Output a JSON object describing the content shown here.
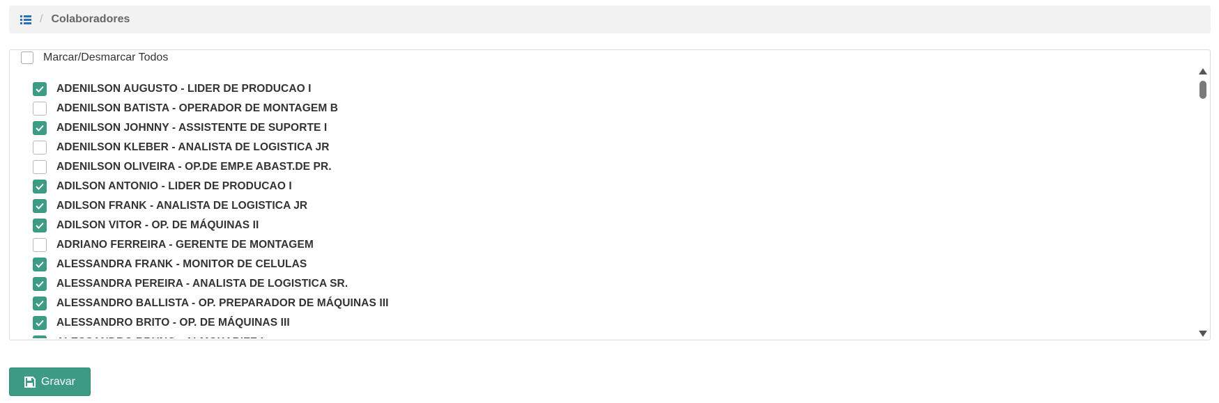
{
  "breadcrumb": {
    "icon": "list-icon",
    "separator": "/",
    "current": "Colaboradores"
  },
  "select_all": {
    "label": "Marcar/Desmarcar Todos",
    "checked": false
  },
  "colors": {
    "accent": "#3d9a85",
    "breadcrumb_bg": "#f2f2f2"
  },
  "collaborators": [
    {
      "label": "ADENILSON AUGUSTO - LIDER DE PRODUCAO I",
      "checked": true
    },
    {
      "label": "ADENILSON BATISTA - OPERADOR DE MONTAGEM B",
      "checked": false
    },
    {
      "label": "ADENILSON JOHNNY - ASSISTENTE DE SUPORTE I",
      "checked": true
    },
    {
      "label": "ADENILSON KLEBER - ANALISTA DE LOGISTICA JR",
      "checked": false
    },
    {
      "label": "ADENILSON OLIVEIRA - OP.DE EMP.E ABAST.DE PR.",
      "checked": false
    },
    {
      "label": "ADILSON ANTONIO - LIDER DE PRODUCAO I",
      "checked": true
    },
    {
      "label": "ADILSON FRANK - ANALISTA DE LOGISTICA JR",
      "checked": true
    },
    {
      "label": "ADILSON VITOR - OP. DE MÁQUINAS II",
      "checked": true
    },
    {
      "label": "ADRIANO FERREIRA - GERENTE DE MONTAGEM",
      "checked": false
    },
    {
      "label": "ALESSANDRA FRANK - MONITOR DE CELULAS",
      "checked": true
    },
    {
      "label": "ALESSANDRA PEREIRA - ANALISTA DE LOGISTICA SR.",
      "checked": true
    },
    {
      "label": "ALESSANDRO BALLISTA - OP. PREPARADOR DE MÁQUINAS III",
      "checked": true
    },
    {
      "label": "ALESSANDRO BRITO - OP. DE MÁQUINAS III",
      "checked": true
    },
    {
      "label": "ALESSANDRO BRUNO - ALMOXARIFE I",
      "checked": true
    }
  ],
  "save_button": {
    "label": "Gravar",
    "icon": "save-icon"
  }
}
